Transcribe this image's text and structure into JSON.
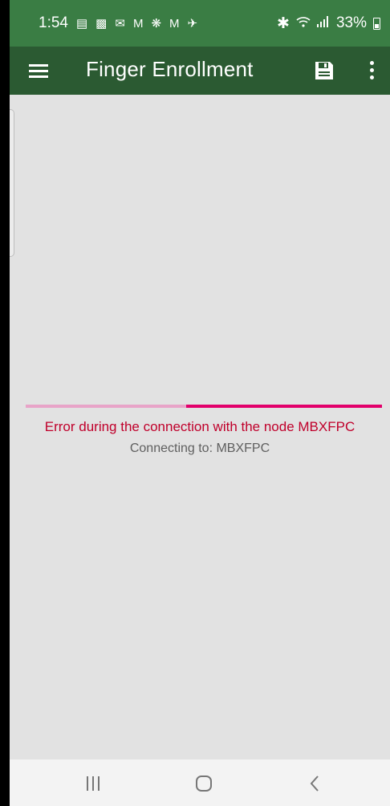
{
  "status_bar": {
    "time": "1:54",
    "battery_percent": "33%",
    "left_icons": [
      "calendar-icon",
      "app-icon",
      "outlook-icon",
      "gmail-icon",
      "walmart-icon",
      "gmail-icon",
      "plane-icon"
    ],
    "right_icons": [
      "bluetooth-icon",
      "wifi-icon",
      "signal-icon",
      "battery-icon"
    ]
  },
  "app_bar": {
    "title": "Finger Enrollment",
    "actions": [
      "save-icon",
      "more-options-icon"
    ]
  },
  "progress": {
    "indeterminate": true
  },
  "messages": {
    "error": "Error during the connection with the node MBXFPC",
    "connecting": "Connecting to: MBXFPC"
  },
  "nav_bar": {
    "buttons": [
      "recents",
      "home",
      "back"
    ]
  },
  "colors": {
    "status_bar": "#3a7d44",
    "app_bar": "#2b5a32",
    "background": "#e2e2e2",
    "accent": "#e2006b",
    "error": "#c0002b"
  }
}
